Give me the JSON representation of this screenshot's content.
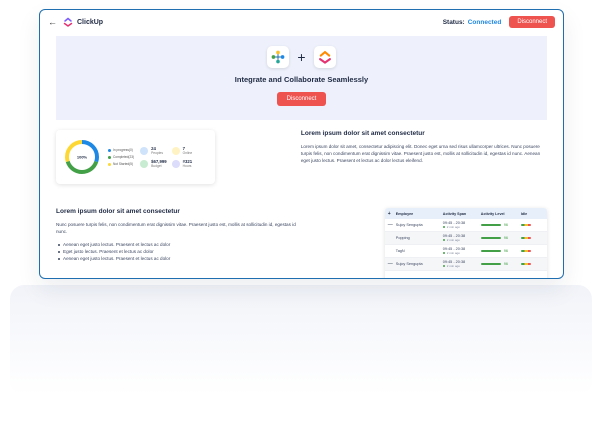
{
  "topbar": {
    "back_glyph": "←",
    "app_name": "ClickUp",
    "status_label": "Status:",
    "status_value": "Connected",
    "disconnect_label": "Disconnect"
  },
  "hero": {
    "plus": "+",
    "title": "Integrate and Collaborate Seamlessly",
    "button_label": "Disconnect"
  },
  "stats_card": {
    "donut_center": "100%",
    "donut_segments": [
      {
        "label": "In progress(0)",
        "color": "#1e88e5",
        "fraction": 0.3
      },
      {
        "label": "Completed(23)",
        "color": "#43a047",
        "fraction": 0.4
      },
      {
        "label": "Not Started(5)",
        "color": "#fdd835",
        "fraction": 0.3
      }
    ],
    "stats": [
      {
        "value": "24",
        "label": "Peoples",
        "color": "#cfe3fb"
      },
      {
        "value": "7",
        "label": "Online",
        "color": "#fff3c4"
      },
      {
        "value": "$67,999",
        "label": "Budget",
        "color": "#c8ecd1"
      },
      {
        "value": "#321",
        "label": "Hours",
        "color": "#dcdcfb"
      }
    ]
  },
  "section1": {
    "heading": "Lorem ipsum dolor sit amet consectetur",
    "body": "Lorem ipsum dolor sit amet, consectetur adipiscing elit. Donec eget urna sed risus ullamcorper ultrices. Nunc posuere turpis felis, non condimentum erat dignissim vitae. Praesent justo est, mollis at sollicitudin id, egestas id nunc. Aenean eget justo lectus. Praesent et lectus ac dolor lectus eleifend."
  },
  "section2": {
    "heading": "Lorem ipsum dolor sit amet consectetur",
    "body": "Nunc posuere turpis felis, non condimentum erat dignissim vitae. Praesent justo est, mollis at sollicitudin id, egestas id nunc.",
    "bullets": [
      "Aenean eget justo lectus. Praesent et lectus ac dolor",
      "Eget justo lectus. Praesent et lectus ac dolor",
      "Aenean eget justo lectus. Praesent et lectus ac dolor"
    ]
  },
  "table": {
    "headers": {
      "plus": "+",
      "employee": "Employee",
      "span": "Activity Span",
      "level": "Activity Level",
      "idle": "Idle"
    },
    "rows": [
      {
        "expand": "—",
        "employee": "Sujoy Sengupta",
        "span": "09:45 - 20:38",
        "ago": "2 min ago",
        "level": "96",
        "alt": false
      },
      {
        "expand": "",
        "employee": "Popping",
        "span": "09:45 - 20:38",
        "ago": "2 min ago",
        "level": "96",
        "alt": true
      },
      {
        "expand": "",
        "employee": "TagN",
        "span": "09:45 - 20:38",
        "ago": "2 min ago",
        "level": "96",
        "alt": false
      },
      {
        "expand": "—",
        "employee": "Sujoy Sengupta",
        "span": "09:45 - 20:38",
        "ago": "2 min ago",
        "level": "96",
        "alt": true
      }
    ]
  }
}
